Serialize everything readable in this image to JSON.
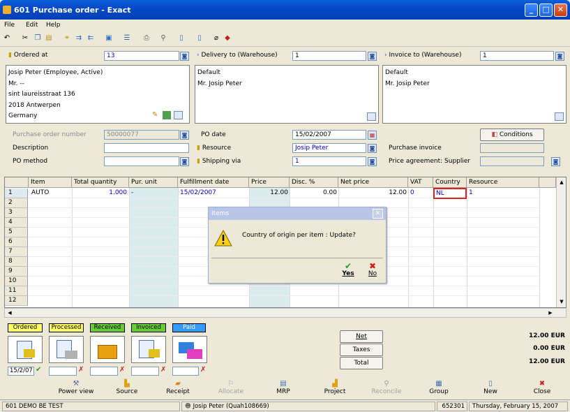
{
  "window": {
    "title": "601 Purchase order - Exact",
    "buttons": {
      "minimize": "_",
      "maximize": "□",
      "close": "✕"
    }
  },
  "menu": {
    "file": "File",
    "edit": "Edit",
    "help": "Help"
  },
  "header": {
    "ordered_at_label": "Ordered at",
    "ordered_at_value": "13",
    "delivery_label": "Delivery to (Warehouse)",
    "delivery_value": "1",
    "invoice_label": "Invoice to (Warehouse)",
    "invoice_value": "1"
  },
  "ordered_box": [
    "Josip Peter (Employee, Active)",
    "Mr. --",
    "sint laureisstraat 136",
    "2018 Antwerpen",
    "Germany"
  ],
  "delivery_box": [
    "Default",
    "Mr. Josip Peter"
  ],
  "invoice_box": [
    "Default",
    "Mr. Josip Peter"
  ],
  "form": {
    "po_number_label": "Purchase order number",
    "po_number_value": "50000077",
    "description_label": "Description",
    "description_value": "",
    "po_method_label": "PO method",
    "po_method_value": "",
    "po_date_label": "PO date",
    "po_date_value": "15/02/2007",
    "resource_label": "Resource",
    "resource_value": "Josip Peter",
    "shipping_label": "Shipping via",
    "shipping_value": "1",
    "conditions_button": "Conditions",
    "purchase_invoice_label": "Purchase invoice",
    "purchase_invoice_value": "",
    "price_agreement_label": "Price agreement: Supplier",
    "price_agreement_value": ""
  },
  "grid": {
    "columns": [
      "Item",
      "Total quantity",
      "Pur. unit",
      "Fulfillment date",
      "Price",
      "Disc. %",
      "Net price",
      "VAT",
      "Country",
      "Resource"
    ],
    "row_numbers": [
      "1",
      "2",
      "3",
      "4",
      "5",
      "6",
      "7",
      "8",
      "9",
      "10",
      "11",
      "12"
    ],
    "row1": {
      "item": "AUTO",
      "qty": "1.000",
      "unit": "-",
      "date": "15/02/2007",
      "price": "12.00",
      "disc": "0.00",
      "net": "12.00",
      "vat": "0",
      "country": "NL",
      "resource": "1"
    }
  },
  "dialog": {
    "title": "Items",
    "message": "Country of origin per item : Update?",
    "yes": "Yes",
    "no": "No",
    "close": "✕"
  },
  "status": {
    "ordered": "Ordered",
    "processed": "Processed",
    "received": "Received",
    "invoiced": "Invoiced",
    "paid": "Paid",
    "ordered_date": "15/2/07",
    "colors": {
      "ordered": "#ffff66",
      "processed": "#ffff66",
      "received": "#66cc33",
      "invoiced": "#66cc33",
      "paid": "#3399ff"
    }
  },
  "totals": {
    "net_label": "Net",
    "taxes_label": "Taxes",
    "total_label": "Total",
    "net_value": "12.00 EUR",
    "taxes_value": "0.00 EUR",
    "total_value": "12.00 EUR"
  },
  "bottom_buttons": [
    {
      "label": "Power view",
      "icon": "power-view-icon"
    },
    {
      "label": "Source",
      "icon": "source-icon"
    },
    {
      "label": "Receipt",
      "icon": "receipt-icon"
    },
    {
      "label": "Allocate",
      "icon": "allocate-icon"
    },
    {
      "label": "MRP",
      "icon": "mrp-icon"
    },
    {
      "label": "Project",
      "icon": "project-icon"
    },
    {
      "label": "Reconcile",
      "icon": "reconcile-icon"
    },
    {
      "label": "Group",
      "icon": "group-icon"
    },
    {
      "label": "New",
      "icon": "new-icon"
    },
    {
      "label": "Close",
      "icon": "close-icon"
    }
  ],
  "statusbar": {
    "company": "601 DEMO BE TEST",
    "user": "Josip Peter (Quah108669)",
    "code": "652301",
    "date": "Thursday, February 15, 2007"
  }
}
